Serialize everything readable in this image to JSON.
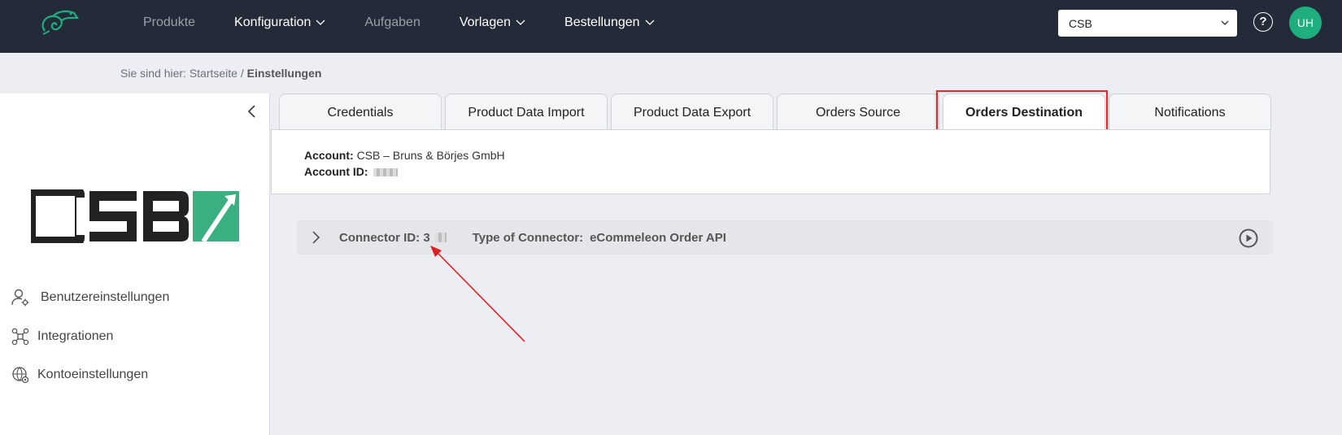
{
  "nav": {
    "items": [
      {
        "label": "Produkte",
        "dim": true,
        "dropdown": false
      },
      {
        "label": "Konfiguration",
        "dim": false,
        "dropdown": true
      },
      {
        "label": "Aufgaben",
        "dim": true,
        "dropdown": false
      },
      {
        "label": "Vorlagen",
        "dim": false,
        "dropdown": true
      },
      {
        "label": "Bestellungen",
        "dim": false,
        "dropdown": true
      }
    ],
    "company_select": "CSB",
    "help": "?",
    "avatar_initials": "UH"
  },
  "breadcrumb": {
    "prefix": "Sie sind hier: Startseite / ",
    "current": "Einstellungen"
  },
  "sidebar": {
    "brand": "CSB",
    "items": [
      {
        "label": "Benutzereinstellungen",
        "icon": "user-settings-icon"
      },
      {
        "label": "Integrationen",
        "icon": "integrations-icon"
      },
      {
        "label": "Kontoeinstellungen",
        "icon": "account-settings-icon"
      }
    ]
  },
  "tabs": [
    {
      "label": "Credentials",
      "active": false
    },
    {
      "label": "Product Data Import",
      "active": false
    },
    {
      "label": "Product Data Export",
      "active": false
    },
    {
      "label": "Orders Source",
      "active": false
    },
    {
      "label": "Orders Destination",
      "active": true
    },
    {
      "label": "Notifications",
      "active": false
    }
  ],
  "account": {
    "account_label": "Account:",
    "account_value": "CSB – Bruns & Börjes GmbH",
    "account_id_label": "Account ID:"
  },
  "connector": {
    "id_label": "Connector ID: 3",
    "type_label": "Type of Connector:",
    "type_value": "eCommeleon Order API"
  },
  "colors": {
    "topbar": "#242b38",
    "accent_green": "#1fae7d",
    "highlight_red": "#dc2b2b"
  }
}
